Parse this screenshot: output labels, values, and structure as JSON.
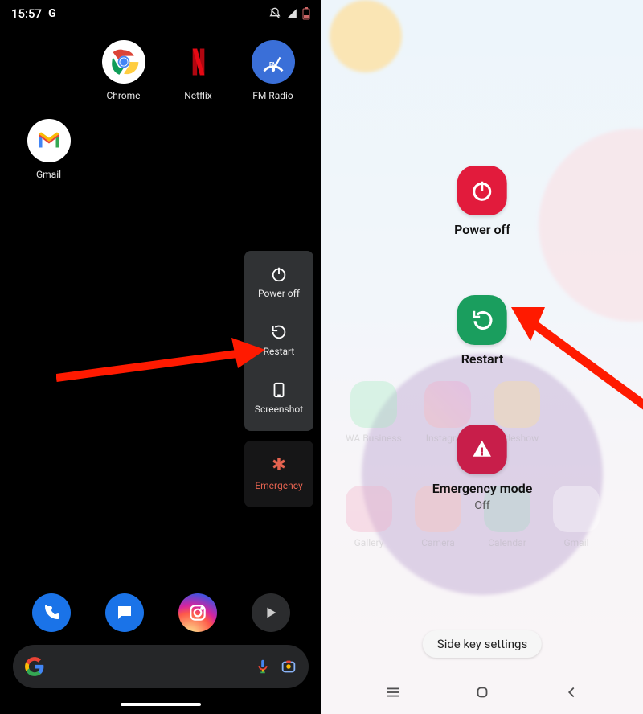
{
  "leftPhone": {
    "status": {
      "time": "15:57",
      "google_badge": "G"
    },
    "apps": {
      "chrome": "Chrome",
      "netflix": "Netflix",
      "fmradio": "FM Radio",
      "gmail": "Gmail"
    },
    "powerMenu": {
      "powerOff": "Power off",
      "restart": "Restart",
      "screenshot": "Screenshot",
      "emergency": "Emergency"
    },
    "dock": {
      "phone": "Phone",
      "messages": "Messages",
      "instagram": "Instagram",
      "play": "Play"
    },
    "search": {
      "placeholder": ""
    }
  },
  "rightPhone": {
    "options": {
      "powerOff": {
        "label": "Power off",
        "color": "#e21b3c"
      },
      "restart": {
        "label": "Restart",
        "color": "#1a9e5e"
      },
      "emergency": {
        "label": "Emergency mode",
        "sub": "Off",
        "color": "#c81e4a"
      }
    },
    "sideKey": "Side key settings",
    "ghostApps": {
      "waBusiness": "WA Business",
      "instagram": "Instagram",
      "slideshow": "Slideshow",
      "gallery": "Gallery",
      "camera": "Camera",
      "calendar": "Calendar",
      "gmail": "Gmail"
    }
  }
}
